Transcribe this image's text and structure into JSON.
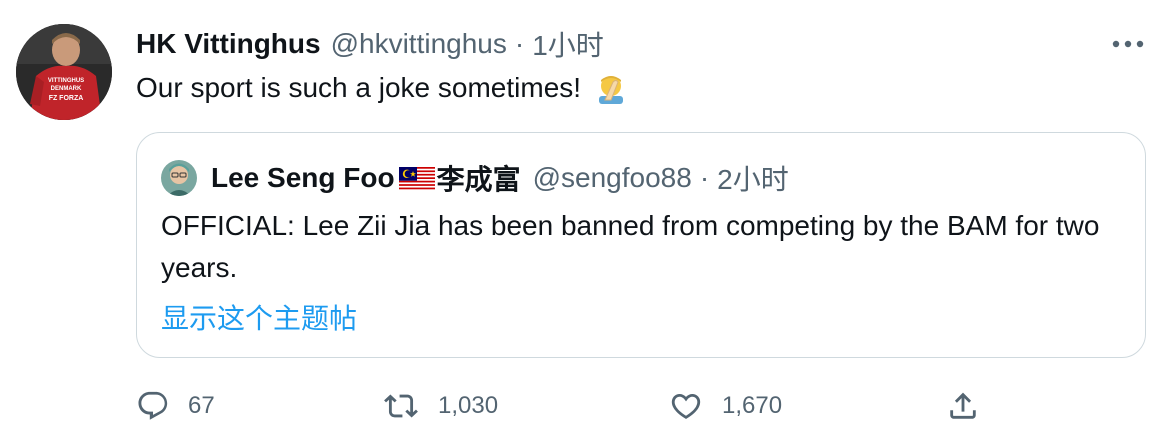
{
  "tweet": {
    "author_name": "HK Vittinghus",
    "author_handle": "@hkvittinghus",
    "separator": "·",
    "time": "1小时",
    "text": "Our sport is such a joke sometimes!",
    "emoji": "facepalm-emoji",
    "avatar_jersey_lines": [
      "VITTINGHUS",
      "DENMARK",
      "FZ FORZA"
    ]
  },
  "quoted": {
    "name": "Lee Seng Foo",
    "flag": "malaysia-flag",
    "name_cn": "李成富",
    "handle": "@sengfoo88",
    "separator": "·",
    "time": "2小时",
    "text": "OFFICIAL: Lee Zii Jia has been banned from competing by the BAM for two years.",
    "show_thread": "显示这个主题帖"
  },
  "actions": {
    "reply_count": "67",
    "retweet_count": "1,030",
    "like_count": "1,670"
  },
  "colors": {
    "text": "#0f1419",
    "secondary": "#536471",
    "link": "#1d9bf0",
    "border": "#cfd9de"
  }
}
